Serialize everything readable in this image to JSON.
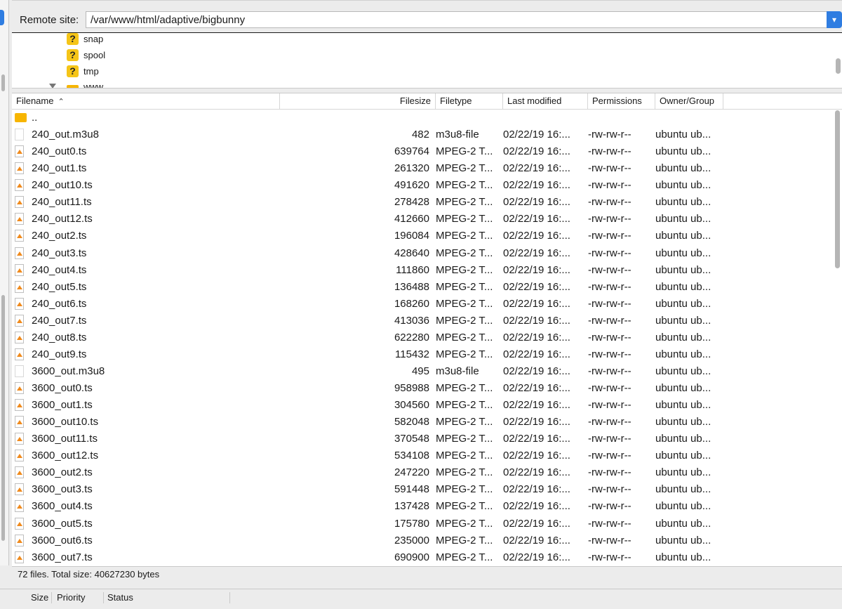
{
  "remote": {
    "label": "Remote site:",
    "path": "/var/www/html/adaptive/bigbunny",
    "dropdown_icon": "chevron-down-icon"
  },
  "tree": {
    "items": [
      {
        "label": "snap",
        "icon": "unknown-folder-icon"
      },
      {
        "label": "spool",
        "icon": "unknown-folder-icon"
      },
      {
        "label": "tmp",
        "icon": "unknown-folder-icon"
      },
      {
        "label": "www",
        "icon": "folder-icon"
      }
    ]
  },
  "filelist": {
    "columns": {
      "filename": "Filename",
      "filesize": "Filesize",
      "filetype": "Filetype",
      "modified": "Last modified",
      "permissions": "Permissions",
      "owner": "Owner/Group"
    },
    "parent": {
      "name": ".."
    },
    "rows": [
      {
        "name": "240_out.m3u8",
        "size": "482",
        "type": "m3u8-file",
        "modified": "02/22/19 16:...",
        "perm": "-rw-rw-r--",
        "owner": "ubuntu ub...",
        "icon": "plain"
      },
      {
        "name": "240_out0.ts",
        "size": "639764",
        "type": "MPEG-2 T...",
        "modified": "02/22/19 16:...",
        "perm": "-rw-rw-r--",
        "owner": "ubuntu ub...",
        "icon": "media"
      },
      {
        "name": "240_out1.ts",
        "size": "261320",
        "type": "MPEG-2 T...",
        "modified": "02/22/19 16:...",
        "perm": "-rw-rw-r--",
        "owner": "ubuntu ub...",
        "icon": "media"
      },
      {
        "name": "240_out10.ts",
        "size": "491620",
        "type": "MPEG-2 T...",
        "modified": "02/22/19 16:...",
        "perm": "-rw-rw-r--",
        "owner": "ubuntu ub...",
        "icon": "media"
      },
      {
        "name": "240_out11.ts",
        "size": "278428",
        "type": "MPEG-2 T...",
        "modified": "02/22/19 16:...",
        "perm": "-rw-rw-r--",
        "owner": "ubuntu ub...",
        "icon": "media"
      },
      {
        "name": "240_out12.ts",
        "size": "412660",
        "type": "MPEG-2 T...",
        "modified": "02/22/19 16:...",
        "perm": "-rw-rw-r--",
        "owner": "ubuntu ub...",
        "icon": "media"
      },
      {
        "name": "240_out2.ts",
        "size": "196084",
        "type": "MPEG-2 T...",
        "modified": "02/22/19 16:...",
        "perm": "-rw-rw-r--",
        "owner": "ubuntu ub...",
        "icon": "media"
      },
      {
        "name": "240_out3.ts",
        "size": "428640",
        "type": "MPEG-2 T...",
        "modified": "02/22/19 16:...",
        "perm": "-rw-rw-r--",
        "owner": "ubuntu ub...",
        "icon": "media"
      },
      {
        "name": "240_out4.ts",
        "size": "111860",
        "type": "MPEG-2 T...",
        "modified": "02/22/19 16:...",
        "perm": "-rw-rw-r--",
        "owner": "ubuntu ub...",
        "icon": "media"
      },
      {
        "name": "240_out5.ts",
        "size": "136488",
        "type": "MPEG-2 T...",
        "modified": "02/22/19 16:...",
        "perm": "-rw-rw-r--",
        "owner": "ubuntu ub...",
        "icon": "media"
      },
      {
        "name": "240_out6.ts",
        "size": "168260",
        "type": "MPEG-2 T...",
        "modified": "02/22/19 16:...",
        "perm": "-rw-rw-r--",
        "owner": "ubuntu ub...",
        "icon": "media"
      },
      {
        "name": "240_out7.ts",
        "size": "413036",
        "type": "MPEG-2 T...",
        "modified": "02/22/19 16:...",
        "perm": "-rw-rw-r--",
        "owner": "ubuntu ub...",
        "icon": "media"
      },
      {
        "name": "240_out8.ts",
        "size": "622280",
        "type": "MPEG-2 T...",
        "modified": "02/22/19 16:...",
        "perm": "-rw-rw-r--",
        "owner": "ubuntu ub...",
        "icon": "media"
      },
      {
        "name": "240_out9.ts",
        "size": "115432",
        "type": "MPEG-2 T...",
        "modified": "02/22/19 16:...",
        "perm": "-rw-rw-r--",
        "owner": "ubuntu ub...",
        "icon": "media"
      },
      {
        "name": "3600_out.m3u8",
        "size": "495",
        "type": "m3u8-file",
        "modified": "02/22/19 16:...",
        "perm": "-rw-rw-r--",
        "owner": "ubuntu ub...",
        "icon": "plain"
      },
      {
        "name": "3600_out0.ts",
        "size": "958988",
        "type": "MPEG-2 T...",
        "modified": "02/22/19 16:...",
        "perm": "-rw-rw-r--",
        "owner": "ubuntu ub...",
        "icon": "media"
      },
      {
        "name": "3600_out1.ts",
        "size": "304560",
        "type": "MPEG-2 T...",
        "modified": "02/22/19 16:...",
        "perm": "-rw-rw-r--",
        "owner": "ubuntu ub...",
        "icon": "media"
      },
      {
        "name": "3600_out10.ts",
        "size": "582048",
        "type": "MPEG-2 T...",
        "modified": "02/22/19 16:...",
        "perm": "-rw-rw-r--",
        "owner": "ubuntu ub...",
        "icon": "media"
      },
      {
        "name": "3600_out11.ts",
        "size": "370548",
        "type": "MPEG-2 T...",
        "modified": "02/22/19 16:...",
        "perm": "-rw-rw-r--",
        "owner": "ubuntu ub...",
        "icon": "media"
      },
      {
        "name": "3600_out12.ts",
        "size": "534108",
        "type": "MPEG-2 T...",
        "modified": "02/22/19 16:...",
        "perm": "-rw-rw-r--",
        "owner": "ubuntu ub...",
        "icon": "media"
      },
      {
        "name": "3600_out2.ts",
        "size": "247220",
        "type": "MPEG-2 T...",
        "modified": "02/22/19 16:...",
        "perm": "-rw-rw-r--",
        "owner": "ubuntu ub...",
        "icon": "media"
      },
      {
        "name": "3600_out3.ts",
        "size": "591448",
        "type": "MPEG-2 T...",
        "modified": "02/22/19 16:...",
        "perm": "-rw-rw-r--",
        "owner": "ubuntu ub...",
        "icon": "media"
      },
      {
        "name": "3600_out4.ts",
        "size": "137428",
        "type": "MPEG-2 T...",
        "modified": "02/22/19 16:...",
        "perm": "-rw-rw-r--",
        "owner": "ubuntu ub...",
        "icon": "media"
      },
      {
        "name": "3600_out5.ts",
        "size": "175780",
        "type": "MPEG-2 T...",
        "modified": "02/22/19 16:...",
        "perm": "-rw-rw-r--",
        "owner": "ubuntu ub...",
        "icon": "media"
      },
      {
        "name": "3600_out6.ts",
        "size": "235000",
        "type": "MPEG-2 T...",
        "modified": "02/22/19 16:...",
        "perm": "-rw-rw-r--",
        "owner": "ubuntu ub...",
        "icon": "media"
      },
      {
        "name": "3600_out7.ts",
        "size": "690900",
        "type": "MPEG-2 T...",
        "modified": "02/22/19 16:...",
        "perm": "-rw-rw-r--",
        "owner": "ubuntu ub...",
        "icon": "media"
      }
    ]
  },
  "status": {
    "text": "72 files. Total size: 40627230 bytes"
  },
  "queue": {
    "columns": {
      "size": "Size",
      "priority": "Priority",
      "status": "Status"
    }
  }
}
